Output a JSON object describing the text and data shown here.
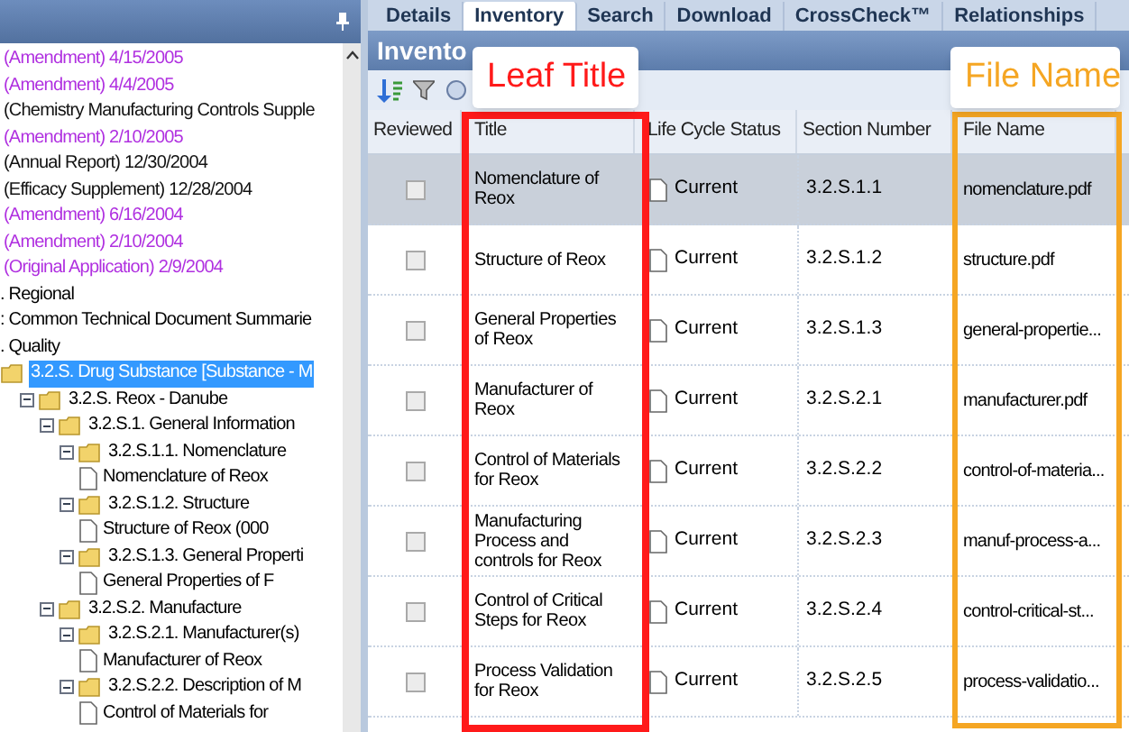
{
  "submissions": [
    {
      "label": "(Amendment) 4/15/2005",
      "color": "#b030e0"
    },
    {
      "label": "(Amendment) 4/4/2005",
      "color": "#b030e0"
    },
    {
      "label": "(Chemistry Manufacturing Controls Supple",
      "color": "#111111"
    },
    {
      "label": "(Amendment) 2/10/2005",
      "color": "#b030e0"
    },
    {
      "label": "(Annual Report) 12/30/2004",
      "color": "#111111"
    },
    {
      "label": "(Efficacy Supplement) 12/28/2004",
      "color": "#111111"
    },
    {
      "label": "(Amendment) 6/16/2004",
      "color": "#b030e0"
    },
    {
      "label": "(Amendment) 2/10/2004",
      "color": "#b030e0"
    },
    {
      "label": "(Original Application) 2/9/2004",
      "color": "#b030e0"
    }
  ],
  "sections": [
    ". Regional",
    ": Common Technical Document Summarie",
    ". Quality"
  ],
  "tree": [
    {
      "label": "3.2.S. Drug Substance [Substance - M",
      "kind": "folder",
      "selected": true,
      "children": [
        {
          "label": "3.2.S. Reox - Danube",
          "kind": "folder",
          "selected": false,
          "expanded": true,
          "children": [
            {
              "label": "3.2.S.1. General Information",
              "kind": "folder",
              "selected": false,
              "expanded": true,
              "children": [
                {
                  "label": "3.2.S.1.1. Nomenclature",
                  "kind": "folder",
                  "selected": false,
                  "expanded": true,
                  "children": [
                    {
                      "label": "Nomenclature of Reox",
                      "kind": "document",
                      "selected": false
                    }
                  ]
                },
                {
                  "label": "3.2.S.1.2. Structure",
                  "kind": "folder",
                  "selected": false,
                  "expanded": true,
                  "children": [
                    {
                      "label": "Structure of Reox (000",
                      "kind": "document",
                      "selected": false
                    }
                  ]
                },
                {
                  "label": "3.2.S.1.3. General Properti",
                  "kind": "folder",
                  "selected": false,
                  "expanded": true,
                  "children": [
                    {
                      "label": "General Properties of F",
                      "kind": "document",
                      "selected": false
                    }
                  ]
                }
              ]
            },
            {
              "label": "3.2.S.2. Manufacture",
              "kind": "folder",
              "selected": false,
              "expanded": true,
              "children": [
                {
                  "label": "3.2.S.2.1. Manufacturer(s)",
                  "kind": "folder",
                  "selected": false,
                  "expanded": true,
                  "children": [
                    {
                      "label": "Manufacturer of Reox",
                      "kind": "document",
                      "selected": false
                    }
                  ]
                },
                {
                  "label": "3.2.S.2.2. Description of M",
                  "kind": "folder",
                  "selected": false,
                  "expanded": true,
                  "children": [
                    {
                      "label": "Control of Materials for",
                      "kind": "document",
                      "selected": false
                    }
                  ]
                }
              ]
            }
          ]
        }
      ]
    }
  ],
  "tabs": [
    {
      "label": "Details",
      "selected": false
    },
    {
      "label": "Inventory",
      "selected": true
    },
    {
      "label": "Search",
      "selected": false
    },
    {
      "label": "Download",
      "selected": false
    },
    {
      "label": "CrossCheck™",
      "selected": false
    },
    {
      "label": "Relationships",
      "selected": false
    }
  ],
  "panel_title": "Invento",
  "table": {
    "columns": [
      "Reviewed",
      "Title",
      "Life Cycle Status",
      "Section Number",
      "File Name"
    ],
    "rows": [
      {
        "selected": true,
        "reviewed": false,
        "title": "Nomenclature of Reox",
        "status": "Current",
        "section": "3.2.S.1.1",
        "file": "nomenclature.pdf"
      },
      {
        "selected": false,
        "reviewed": false,
        "title": "Structure of Reox",
        "status": "Current",
        "section": "3.2.S.1.2",
        "file": "structure.pdf"
      },
      {
        "selected": false,
        "reviewed": false,
        "title": "General Properties of Reox",
        "status": "Current",
        "section": "3.2.S.1.3",
        "file": "general-propertie..."
      },
      {
        "selected": false,
        "reviewed": false,
        "title": "Manufacturer of Reox",
        "status": "Current",
        "section": "3.2.S.2.1",
        "file": "manufacturer.pdf"
      },
      {
        "selected": false,
        "reviewed": false,
        "title": "Control of Materials for Reox",
        "status": "Current",
        "section": "3.2.S.2.2",
        "file": "control-of-materia..."
      },
      {
        "selected": false,
        "reviewed": false,
        "title": "Manufacturing Process and controls for Reox",
        "status": "Current",
        "section": "3.2.S.2.3",
        "file": "manuf-process-a..."
      },
      {
        "selected": false,
        "reviewed": false,
        "title": "Control of Critical Steps for Reox",
        "status": "Current",
        "section": "3.2.S.2.4",
        "file": "control-critical-st..."
      },
      {
        "selected": false,
        "reviewed": false,
        "title": "Process Validation for Reox",
        "status": "Current",
        "section": "3.2.S.2.5",
        "file": "process-validatio..."
      }
    ]
  },
  "callouts": [
    {
      "label": "Leaf Title",
      "color": "#ff1a1a"
    },
    {
      "label": "File Name",
      "color": "#f5a623"
    }
  ]
}
